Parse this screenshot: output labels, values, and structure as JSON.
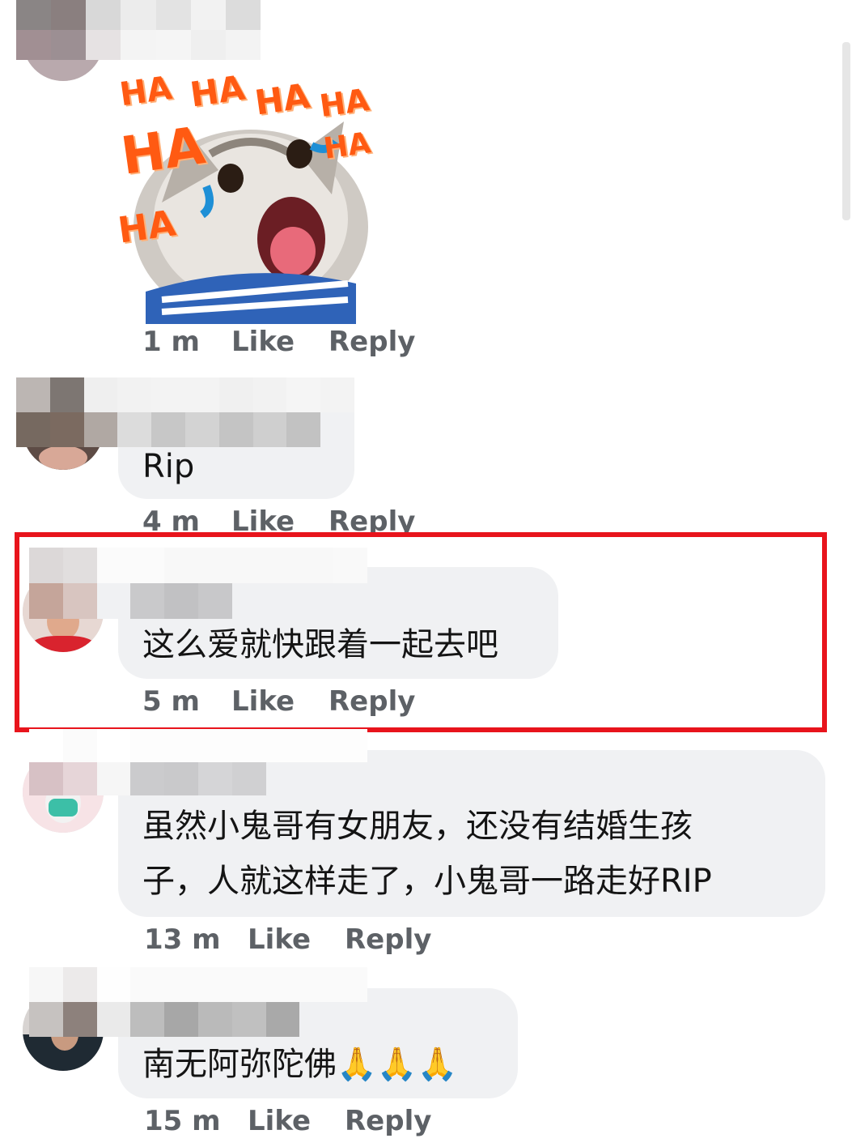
{
  "comments": [
    {
      "id": "c1",
      "sticker": {
        "name": "cat-laughing-sticker",
        "words": [
          "HA",
          "HA",
          "HA",
          "HA",
          "HA",
          "HA",
          "HA"
        ]
      },
      "time": "1 m",
      "like": "Like",
      "reply": "Reply"
    },
    {
      "id": "c2",
      "text": "Rip",
      "time": "4 m",
      "like": "Like",
      "reply": "Reply"
    },
    {
      "id": "c3",
      "text": "这么爱就快跟着一起去吧",
      "time": "5 m",
      "like": "Like",
      "reply": "Reply",
      "highlighted": true
    },
    {
      "id": "c4",
      "text_line1": "虽然小鬼哥有女朋友，还没有结婚生孩",
      "text_line2": "子，人就这样走了，小鬼哥一路走好RIP",
      "time": "13 m",
      "like": "Like",
      "reply": "Reply"
    },
    {
      "id": "c5",
      "text": "南无阿弥陀佛🙏🙏🙏",
      "time": "15 m",
      "like": "Like",
      "reply": "Reply"
    }
  ],
  "colors": {
    "highlight": "#e8141c",
    "bubble": "#f0f1f3",
    "meta": "#5d6166"
  }
}
